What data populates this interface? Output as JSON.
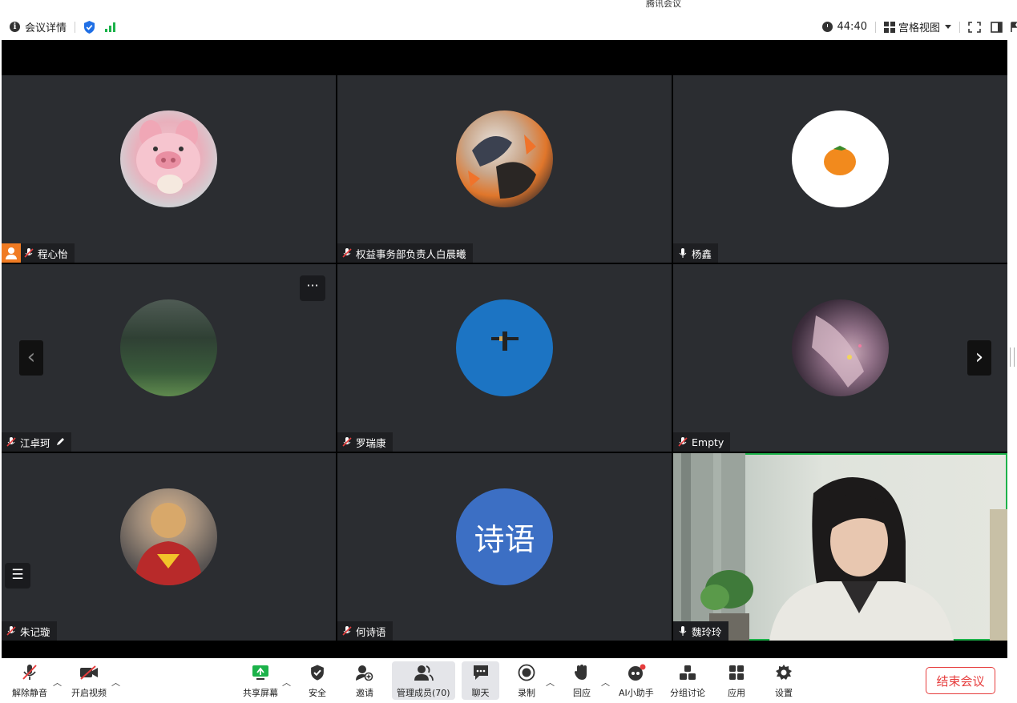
{
  "window": {
    "title": "腾讯会议"
  },
  "topbar": {
    "meeting_details_label": "会议详情",
    "timer": "44:40",
    "view_mode_label": "宫格视图"
  },
  "participants": [
    {
      "name": "程心怡",
      "mic": "muted",
      "host": true
    },
    {
      "name": "权益事务部负责人白晨曦",
      "mic": "muted"
    },
    {
      "name": "杨鑫",
      "mic": "on"
    },
    {
      "name": "江卓珂",
      "mic": "muted",
      "annotating": true
    },
    {
      "name": "罗瑞康",
      "mic": "muted"
    },
    {
      "name": "Empty",
      "mic": "muted"
    },
    {
      "name": "朱记璇",
      "mic": "muted"
    },
    {
      "name": "何诗语",
      "mic": "muted",
      "avatar_text": "诗语"
    },
    {
      "name": "魏玲玲",
      "mic": "on",
      "video": true,
      "speaking": true
    }
  ],
  "toolbar": {
    "unmute": "解除静音",
    "start_video": "开启视频",
    "share_screen": "共享屏幕",
    "security": "安全",
    "invite": "邀请",
    "manage_members": "管理成员(70)",
    "chat": "聊天",
    "record": "录制",
    "reactions": "回应",
    "ai_assistant": "AI小助手",
    "breakout": "分组讨论",
    "apps": "应用",
    "settings": "设置",
    "end_meeting": "结束会议"
  },
  "colors": {
    "host_badge": "#f07b23",
    "active_speaker": "#1cb24a",
    "end_meeting": "#e63d3d",
    "shield": "#1f6fe5",
    "chat_avatar": "#3c6fc4"
  }
}
